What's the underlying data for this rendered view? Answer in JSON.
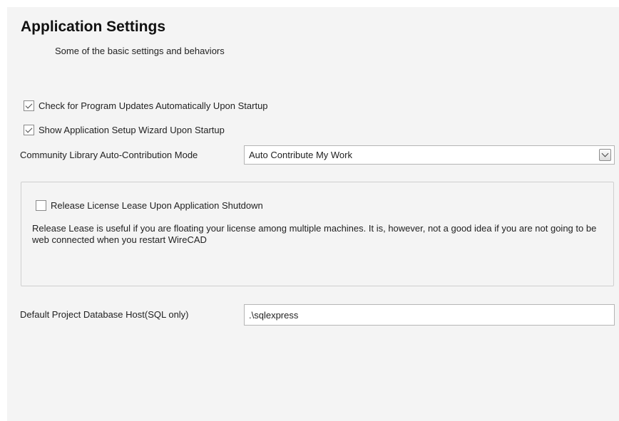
{
  "header": {
    "title": "Application Settings",
    "subtitle": "Some of the basic settings and behaviors"
  },
  "options": {
    "check_updates": {
      "label": "Check for Program Updates Automatically Upon Startup",
      "checked": true
    },
    "show_wizard": {
      "label": "Show Application Setup Wizard Upon Startup",
      "checked": true
    }
  },
  "community_library": {
    "label": "Community Library Auto-Contribution Mode",
    "selected": "Auto Contribute My Work"
  },
  "license_group": {
    "release_lease": {
      "label": "Release License Lease Upon Application Shutdown",
      "checked": false
    },
    "description": "Release Lease is useful if you are floating your license among multiple machines. It is, however, not a good idea if you are not going to be web connected when you restart WireCAD"
  },
  "database": {
    "label": "Default Project Database Host(SQL only)",
    "value": ".\\sqlexpress"
  },
  "icons": {
    "combo_arrow": "chevron-down-icon",
    "checkbox_checked": "checkmark-icon"
  }
}
